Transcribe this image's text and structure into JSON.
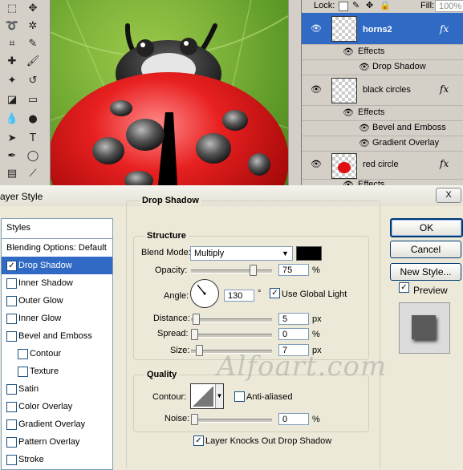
{
  "layers_panel": {
    "lock_label": "Lock:",
    "fill_label": "Fill:",
    "fill_value": "100%",
    "layers": [
      {
        "name": "horns2",
        "selected": true
      },
      {
        "name": "black circles",
        "selected": false
      },
      {
        "name": "red circle",
        "selected": false
      }
    ],
    "effects_label": "Effects",
    "effect_items": [
      "Drop Shadow",
      "Bevel and Emboss",
      "Gradient Overlay"
    ],
    "fx_label": "fx"
  },
  "dialog": {
    "title": "ayer Style",
    "close_label": "X",
    "styles": [
      {
        "label": "Styles",
        "checkbox": false,
        "checked": false,
        "selected": false
      },
      {
        "label": "Blending Options: Default",
        "checkbox": false,
        "checked": false,
        "selected": false
      },
      {
        "label": "Drop Shadow",
        "checkbox": true,
        "checked": true,
        "selected": true
      },
      {
        "label": "Inner Shadow",
        "checkbox": true,
        "checked": false,
        "selected": false
      },
      {
        "label": "Outer Glow",
        "checkbox": true,
        "checked": false,
        "selected": false
      },
      {
        "label": "Inner Glow",
        "checkbox": true,
        "checked": false,
        "selected": false
      },
      {
        "label": "Bevel and Emboss",
        "checkbox": true,
        "checked": false,
        "selected": false
      },
      {
        "label": "Contour",
        "checkbox": true,
        "checked": false,
        "selected": false
      },
      {
        "label": "Texture",
        "checkbox": true,
        "checked": false,
        "selected": false
      },
      {
        "label": "Satin",
        "checkbox": true,
        "checked": false,
        "selected": false
      },
      {
        "label": "Color Overlay",
        "checkbox": true,
        "checked": false,
        "selected": false
      },
      {
        "label": "Gradient Overlay",
        "checkbox": true,
        "checked": false,
        "selected": false
      },
      {
        "label": "Pattern Overlay",
        "checkbox": true,
        "checked": false,
        "selected": false
      },
      {
        "label": "Stroke",
        "checkbox": true,
        "checked": false,
        "selected": false
      }
    ],
    "drop_shadow": {
      "section_title": "Drop Shadow",
      "structure_title": "Structure",
      "blend_mode_label": "Blend Mode:",
      "blend_mode_value": "Multiply",
      "shadow_color": "#000000",
      "opacity_label": "Opacity:",
      "opacity_value": "75",
      "opacity_unit": "%",
      "opacity_level": 0.75,
      "angle_label": "Angle:",
      "angle_value": "130",
      "angle_unit": "°",
      "use_global_light_label": "Use Global Light",
      "use_global_light_checked": true,
      "distance_label": "Distance:",
      "distance_value": "5",
      "distance_unit": "px",
      "spread_label": "Spread:",
      "spread_value": "0",
      "spread_unit": "%",
      "size_label": "Size:",
      "size_value": "7",
      "size_unit": "px",
      "quality_title": "Quality",
      "contour_label": "Contour:",
      "anti_aliased_label": "Anti-aliased",
      "noise_label": "Noise:",
      "noise_value": "0",
      "noise_unit": "%",
      "layer_knocks_out_label": "Layer Knocks Out Drop Shadow",
      "layer_knocks_out_checked": true
    },
    "buttons": {
      "ok": "OK",
      "cancel": "Cancel",
      "new_style": "New Style...",
      "preview_label": "Preview"
    },
    "check_mark": "✓"
  },
  "watermark": "Alfoart.com"
}
